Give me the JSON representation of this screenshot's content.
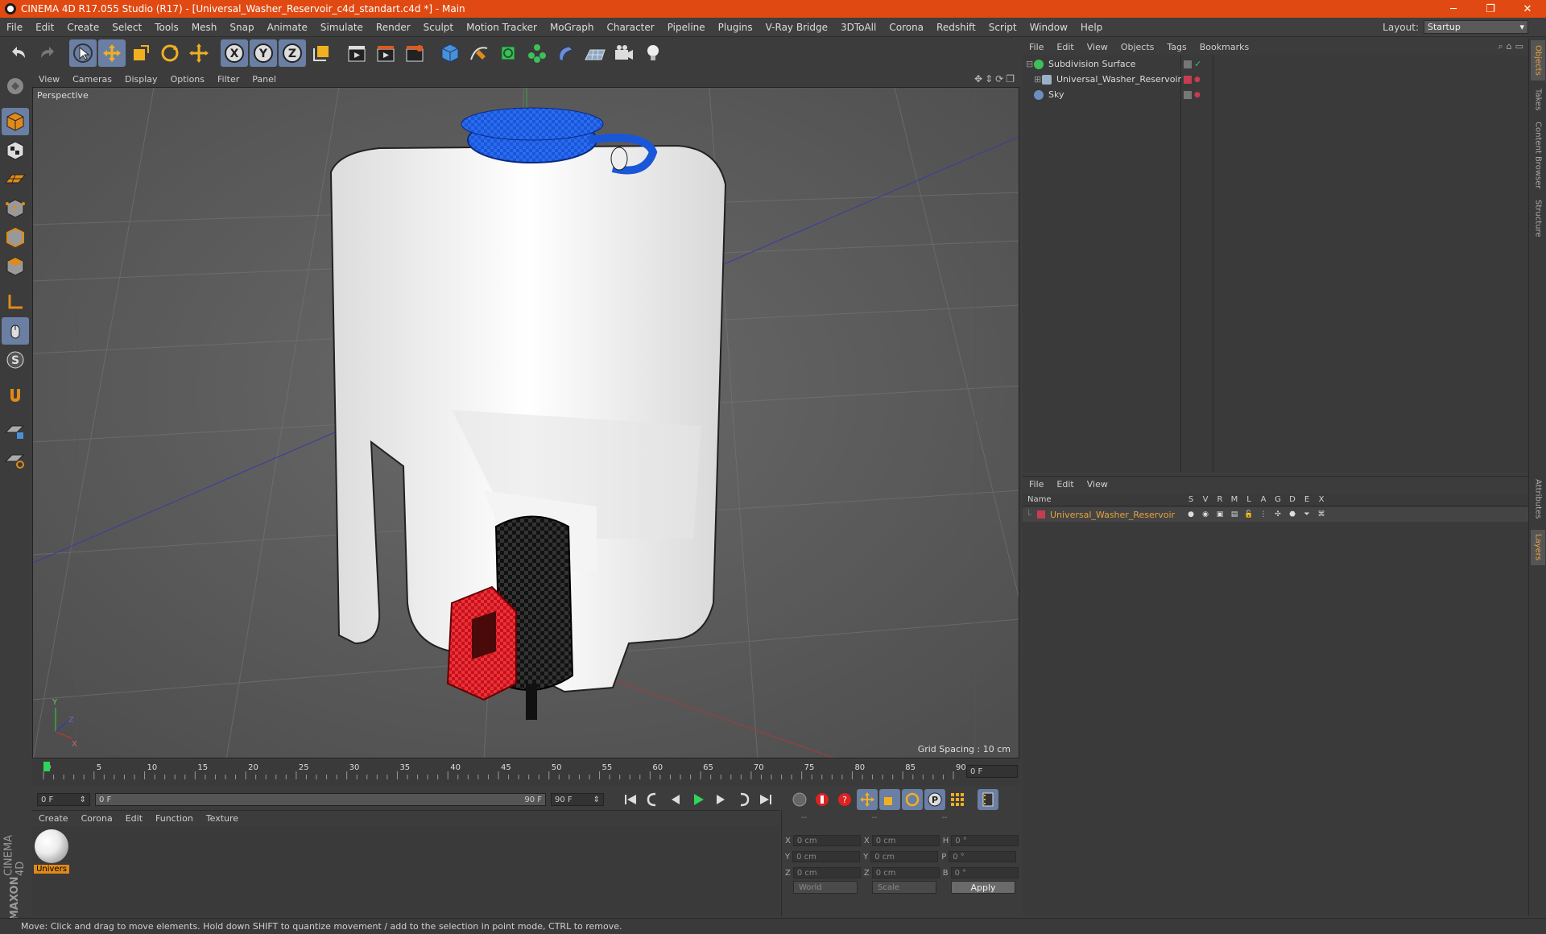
{
  "window": {
    "title": "CINEMA 4D R17.055 Studio (R17) - [Universal_Washer_Reservoir_c4d_standart.c4d *] - Main",
    "minimize": "─",
    "restore": "❐",
    "close": "✕"
  },
  "menubar": {
    "items": [
      "File",
      "Edit",
      "Create",
      "Select",
      "Tools",
      "Mesh",
      "Snap",
      "Animate",
      "Simulate",
      "Render",
      "Sculpt",
      "Motion Tracker",
      "MoGraph",
      "Character",
      "Pipeline",
      "Plugins",
      "V-Ray Bridge",
      "3DToAll",
      "Corona",
      "Redshift",
      "Script",
      "Window",
      "Help"
    ],
    "layout_label": "Layout:",
    "layout_value": "Startup"
  },
  "viewport": {
    "menu": [
      "View",
      "Cameras",
      "Display",
      "Options",
      "Filter",
      "Panel"
    ],
    "view_name": "Perspective",
    "grid_spacing": "Grid Spacing : 10 cm",
    "axis_labels": {
      "y": "Y",
      "z": "Z",
      "x": "X"
    }
  },
  "timeline": {
    "ticks": [
      "0",
      "5",
      "10",
      "15",
      "20",
      "25",
      "30",
      "35",
      "40",
      "45",
      "50",
      "55",
      "60",
      "65",
      "70",
      "75",
      "80",
      "85",
      "90"
    ],
    "current_frame_box": "0 F",
    "start_field": "0 F",
    "range_start": "0 F",
    "range_end": "90 F",
    "end_field": "90 F",
    "playhead_fraction": 0.0
  },
  "materials": {
    "menu": [
      "Create",
      "Corona",
      "Edit",
      "Function",
      "Texture"
    ],
    "items": [
      {
        "label": "Univers"
      }
    ]
  },
  "coordinates": {
    "header": [
      "--",
      "--",
      "--"
    ],
    "rows": [
      {
        "a": "X",
        "av": "0 cm",
        "b": "X",
        "bv": "0 cm",
        "c": "H",
        "cv": "0 °"
      },
      {
        "a": "Y",
        "av": "0 cm",
        "b": "Y",
        "bv": "0 cm",
        "c": "P",
        "cv": "0 °"
      },
      {
        "a": "Z",
        "av": "0 cm",
        "b": "Z",
        "bv": "0 cm",
        "c": "B",
        "cv": "0 °"
      }
    ],
    "world": "World",
    "scale": "Scale",
    "apply": "Apply"
  },
  "objects_panel": {
    "menu": [
      "File",
      "Edit",
      "View",
      "Objects",
      "Tags",
      "Bookmarks"
    ],
    "rows": [
      {
        "name": "Subdivision Surface",
        "color": "#3fbf5a"
      },
      {
        "name": "Universal_Washer_Reservoir",
        "color": "#9ab0c8"
      },
      {
        "name": "Sky",
        "color": "#6a8fc0"
      }
    ]
  },
  "layers_panel": {
    "menu": [
      "File",
      "Edit",
      "View"
    ],
    "name_header": "Name",
    "columns": [
      "S",
      "V",
      "R",
      "M",
      "L",
      "A",
      "G",
      "D",
      "E",
      "X"
    ],
    "rows": [
      {
        "name": "Universal_Washer_Reservoir",
        "color": "#c83c50"
      }
    ]
  },
  "side_tabs": [
    "Objects",
    "Takes",
    "Content Browser",
    "Structure",
    "Attributes",
    "Layers"
  ],
  "logo": {
    "line1": "MAXON",
    "line2": "CINEMA 4D"
  },
  "status": "Move: Click and drag to move elements. Hold down SHIFT to quantize movement / add to the selection in point mode, CTRL to remove.",
  "colors": {
    "accent": "#e04a12",
    "selected_tool": "#6a7fa3",
    "layer_name": "#e6a23c"
  }
}
